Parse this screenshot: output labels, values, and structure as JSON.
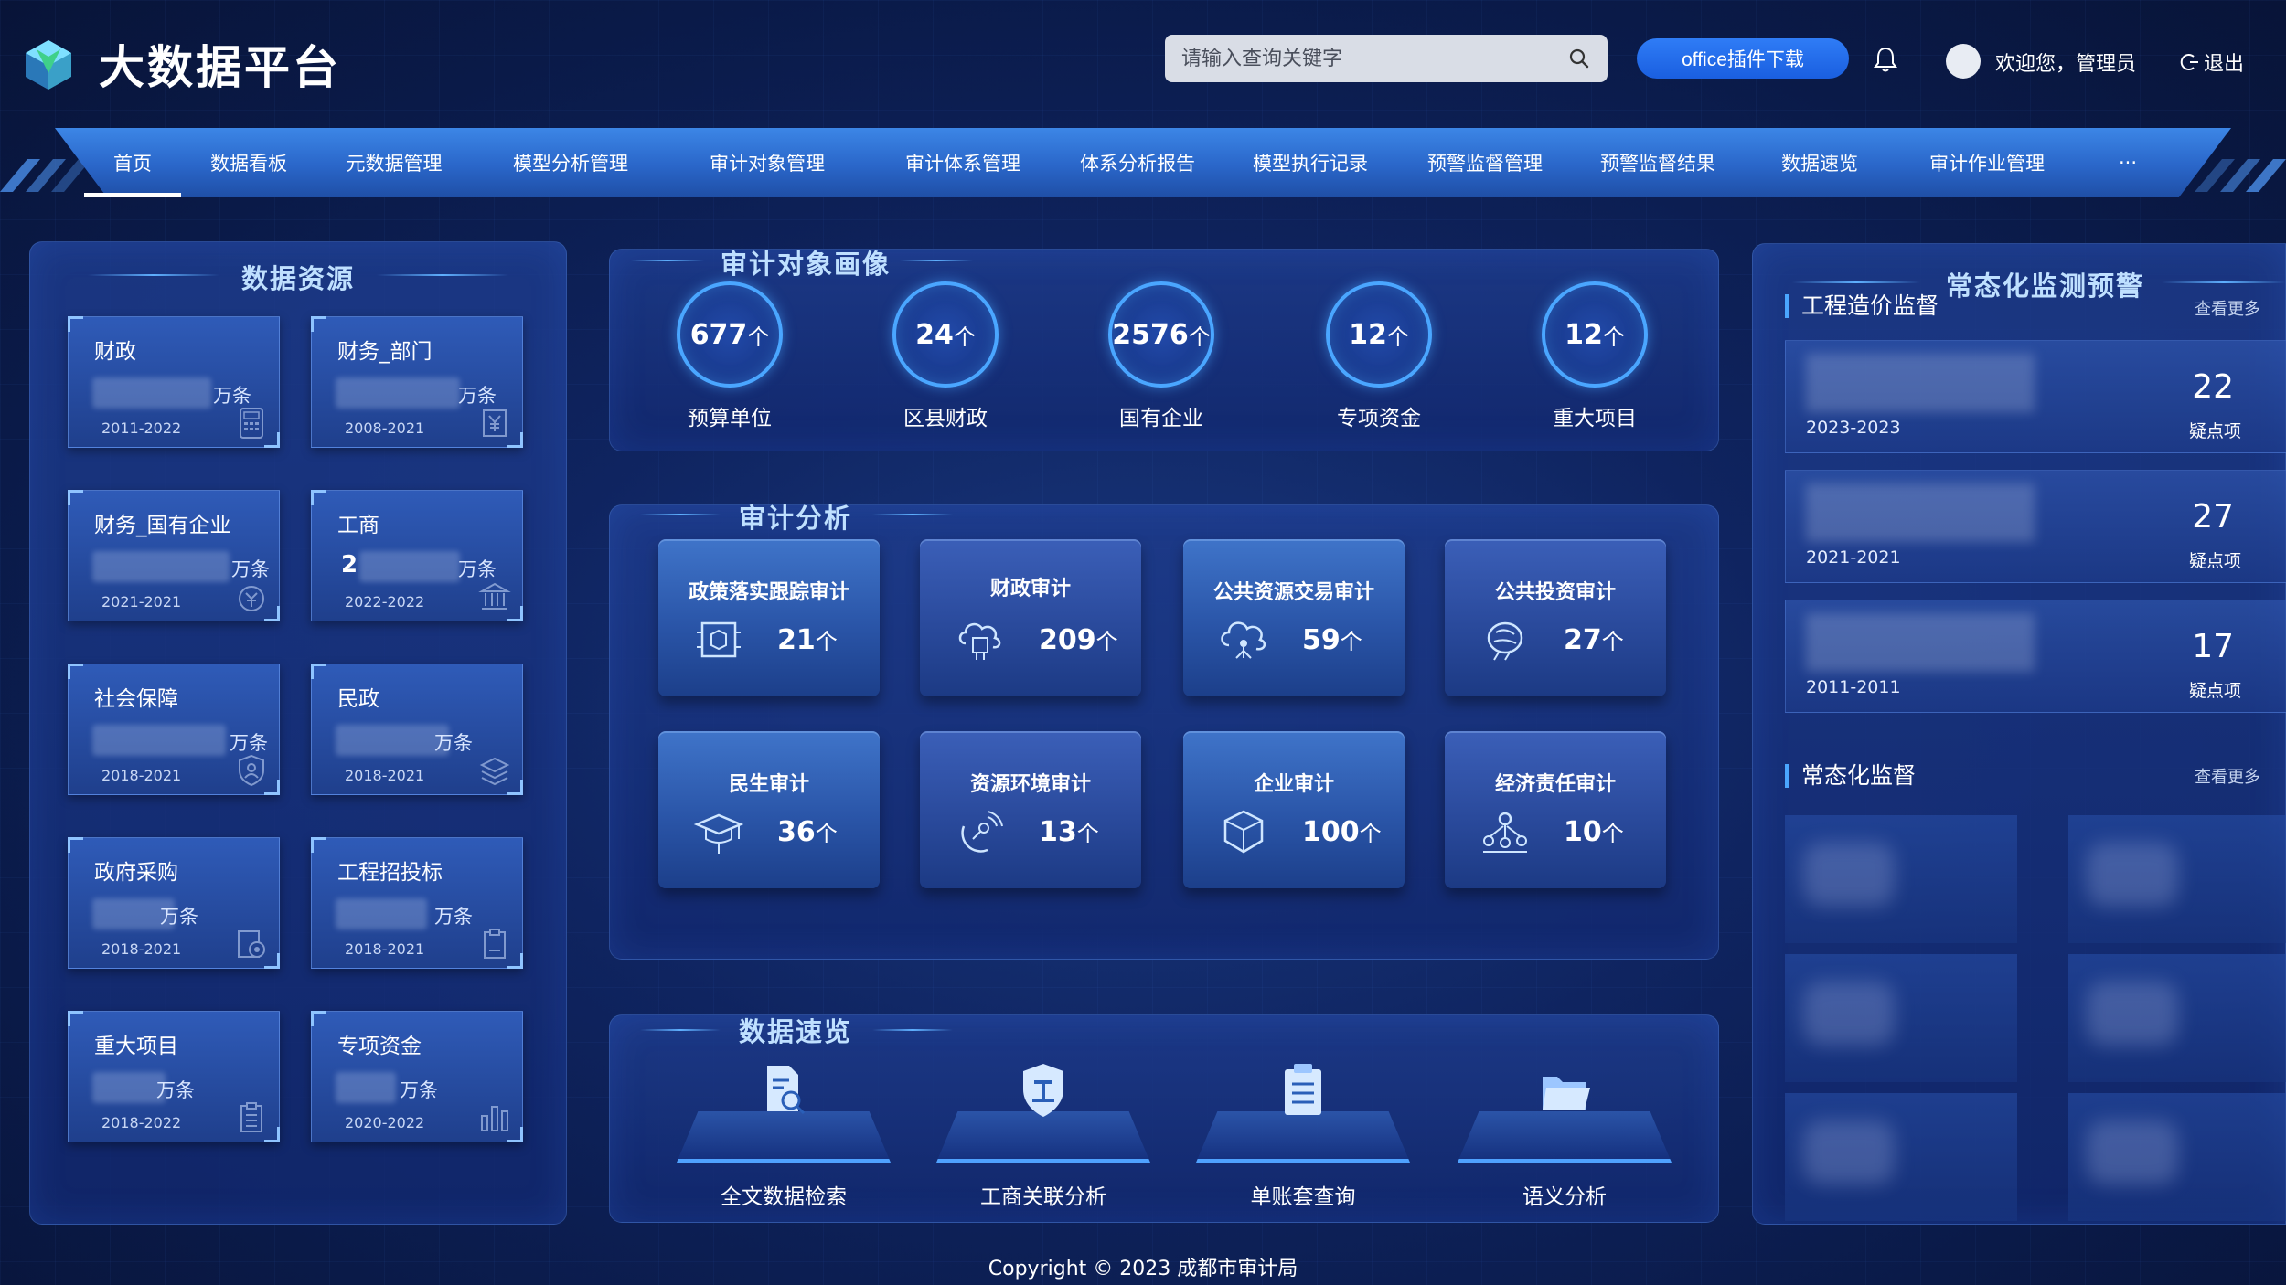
{
  "header": {
    "title": "大数据平台",
    "search_placeholder": "请输入查询关键字",
    "office_button": "office插件下载",
    "welcome": "欢迎您，管理员",
    "logout": "退出"
  },
  "nav": {
    "items": [
      "首页",
      "数据看板",
      "元数据管理",
      "模型分析管理",
      "审计对象管理",
      "审计体系管理",
      "体系分析报告",
      "模型执行记录",
      "预警监督管理",
      "预警监督结果",
      "数据速览",
      "审计作业管理",
      "···"
    ],
    "active_index": 0
  },
  "data_resources": {
    "title": "数据资源",
    "cards": [
      {
        "name": "财政",
        "unit": "万条",
        "years": "2011-2022",
        "icon": "calculator-icon"
      },
      {
        "name": "财务_部门",
        "unit": "万条",
        "years": "2008-2021",
        "icon": "yen-doc-icon"
      },
      {
        "name": "财务_国有企业",
        "unit": "万条",
        "years": "2021-2021",
        "icon": "yen-coin-icon"
      },
      {
        "name": "工商",
        "unit": "万条",
        "years": "2022-2022",
        "digit": "2",
        "icon": "bank-icon"
      },
      {
        "name": "社会保障",
        "unit": "万条",
        "years": "2018-2021",
        "icon": "shield-person-icon"
      },
      {
        "name": "民政",
        "unit": "万条",
        "years": "2018-2021",
        "icon": "stack-icon"
      },
      {
        "name": "政府采购",
        "unit": "万条",
        "years": "2018-2021",
        "icon": "target-doc-icon"
      },
      {
        "name": "工程招投标",
        "unit": "万条",
        "years": "2018-2021",
        "icon": "clipboard-icon"
      },
      {
        "name": "重大项目",
        "unit": "万条",
        "years": "2018-2022",
        "icon": "clipboard-list-icon"
      },
      {
        "name": "专项资金",
        "unit": "万条",
        "years": "2020-2022",
        "icon": "bars-icon"
      }
    ]
  },
  "audit_objects": {
    "title": "审计对象画像",
    "items": [
      {
        "value": "677",
        "unit": "个",
        "label": "预算单位"
      },
      {
        "value": "24",
        "unit": "个",
        "label": "区县财政"
      },
      {
        "value": "2576",
        "unit": "个",
        "label": "国有企业"
      },
      {
        "value": "12",
        "unit": "个",
        "label": "专项资金"
      },
      {
        "value": "12",
        "unit": "个",
        "label": "重大项目"
      }
    ]
  },
  "audit_analysis": {
    "title": "审计分析",
    "items": [
      {
        "title": "政策落实跟踪审计",
        "value": "21",
        "unit": "个",
        "icon": "chip-icon"
      },
      {
        "title": "财政审计",
        "value": "209",
        "unit": "个",
        "icon": "cloud-chip-icon"
      },
      {
        "title": "公共资源交易审计",
        "value": "59",
        "unit": "个",
        "icon": "cloud-network-icon"
      },
      {
        "title": "公共投资审计",
        "value": "27",
        "unit": "个",
        "icon": "brain-icon"
      },
      {
        "title": "民生审计",
        "value": "36",
        "unit": "个",
        "icon": "graduation-cap-icon"
      },
      {
        "title": "资源环境审计",
        "value": "13",
        "unit": "个",
        "icon": "satellite-icon"
      },
      {
        "title": "企业审计",
        "value": "100",
        "unit": "个",
        "icon": "cube-icon"
      },
      {
        "title": "经济责任审计",
        "value": "10",
        "unit": "个",
        "icon": "network-people-icon"
      }
    ]
  },
  "quick_data": {
    "title": "数据速览",
    "items": [
      {
        "label": "全文数据检索",
        "icon": "doc-search-icon"
      },
      {
        "label": "工商关联分析",
        "icon": "shield-gong-icon"
      },
      {
        "label": "单账套查询",
        "icon": "clipboard-icon"
      },
      {
        "label": "语义分析",
        "icon": "folder-icon"
      }
    ]
  },
  "monitoring": {
    "title": "常态化监测预警",
    "engineering": {
      "title": "工程造价监督",
      "see_more": "查看更多",
      "rows": [
        {
          "years": "2023-2023",
          "count": "22",
          "label": "疑点项"
        },
        {
          "years": "2021-2021",
          "count": "27",
          "label": "疑点项"
        },
        {
          "years": "2011-2011",
          "count": "17",
          "label": "疑点项"
        }
      ]
    },
    "regular": {
      "title": "常态化监督",
      "see_more": "查看更多"
    }
  },
  "footer": {
    "copyright": "Copyright © 2023 成都市审计局"
  },
  "colors": {
    "accent": "#4aa6ff",
    "nav": "#2f74d8",
    "office_button": "#2270f0"
  }
}
